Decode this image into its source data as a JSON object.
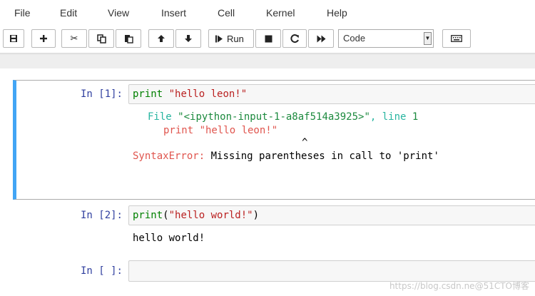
{
  "menu": [
    "File",
    "Edit",
    "View",
    "Insert",
    "Cell",
    "Kernel",
    "Help"
  ],
  "toolbar": {
    "run_label": "Run",
    "cell_type": "Code"
  },
  "cells": [
    {
      "prompt": "In [1]:",
      "code": {
        "kw": "print",
        "str": " \"hello leon!\""
      },
      "traceback": {
        "file_prefix": "File ",
        "file_name": "\"<ipython-input-1-a8af514a3925>\"",
        "line_prefix": ", line ",
        "line_no": "1",
        "source_line": "print \"hello leon!\"",
        "caret": "^",
        "error_type": "SyntaxError:",
        "error_msg": " Missing parentheses in call to 'print'"
      }
    },
    {
      "prompt": "In [2]:",
      "code": {
        "kw": "print",
        "open": "(",
        "str": "\"hello world!\"",
        "close": ")"
      },
      "output": "hello world!"
    },
    {
      "prompt": "In [ ]:"
    }
  ],
  "watermark": "https://blog.csdn.ne@51CTO博客",
  "colors": {
    "selected_cell_bar": "#42a5f5",
    "prompt": "#303f9f"
  }
}
